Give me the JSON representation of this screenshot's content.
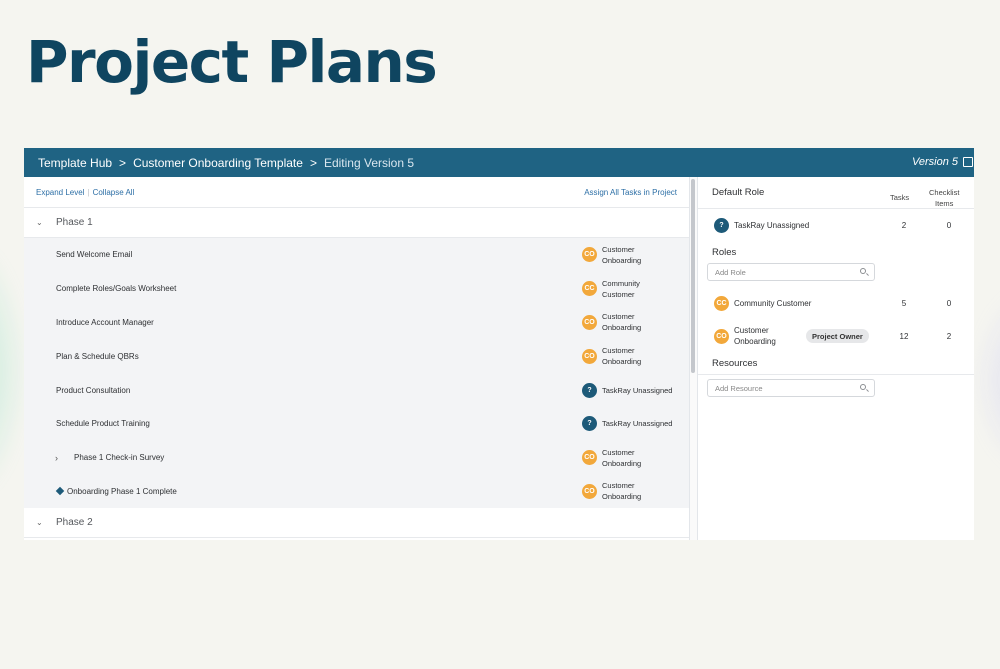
{
  "page": {
    "title": "Project Plans"
  },
  "breadcrumb": {
    "items": [
      "Template Hub",
      "Customer Onboarding Template",
      "Editing Version 5"
    ],
    "separator": ">",
    "version_label": "Version 5"
  },
  "toolbar": {
    "expand_level": "Expand Level",
    "collapse_all": "Collapse All",
    "assign_all": "Assign All Tasks in Project"
  },
  "phases": [
    {
      "label": "Phase 1",
      "expanded": true,
      "tasks": [
        {
          "name": "Send Welcome Email",
          "owner_line1": "Customer",
          "owner_line2": "Onboarding",
          "owner_type": "CO"
        },
        {
          "name": "Complete Roles/Goals Worksheet",
          "owner_line1": "Community",
          "owner_line2": "Customer",
          "owner_type": "CC"
        },
        {
          "name": "Introduce Account Manager",
          "owner_line1": "Customer",
          "owner_line2": "Onboarding",
          "owner_type": "CO"
        },
        {
          "name": "Plan & Schedule QBRs",
          "owner_line1": "Customer",
          "owner_line2": "Onboarding",
          "owner_type": "CO"
        },
        {
          "name": "Product Consultation",
          "owner_line1": "TaskRay Unassigned",
          "owner_line2": "",
          "owner_type": "?"
        },
        {
          "name": "Schedule Product Training",
          "owner_line1": "TaskRay Unassigned",
          "owner_line2": "",
          "owner_type": "?"
        },
        {
          "name": "Phase 1 Check-in Survey",
          "owner_line1": "Customer",
          "owner_line2": "Onboarding",
          "owner_type": "CO"
        },
        {
          "name": "Onboarding Phase 1 Complete",
          "owner_line1": "Customer",
          "owner_line2": "Onboarding",
          "owner_type": "CO"
        }
      ]
    },
    {
      "label": "Phase 2",
      "expanded": true,
      "tasks": []
    }
  ],
  "right_panel": {
    "default_role_title": "Default Role",
    "col_tasks": "Tasks",
    "col_checklist_1": "Checklist",
    "col_checklist_2": "Items",
    "default_role": {
      "badge": "?",
      "name": "TaskRay Unassigned",
      "tasks": "2",
      "checklist": "0"
    },
    "roles_title": "Roles",
    "add_role_placeholder": "Add Role",
    "roles": [
      {
        "badge": "CC",
        "name": "Community Customer",
        "name2": "",
        "tasks": "5",
        "checklist": "0",
        "pill": ""
      },
      {
        "badge": "CO",
        "name": "Customer",
        "name2": "Onboarding",
        "tasks": "12",
        "checklist": "2",
        "pill": "Project Owner"
      }
    ],
    "resources_title": "Resources",
    "add_resource_placeholder": "Add Resource"
  },
  "colors": {
    "title": "#0f4560",
    "topbar": "#1f6383",
    "avatar_orange": "#f2a83b",
    "avatar_blue": "#1d5a79",
    "link": "#2d6fa6"
  },
  "icons": {
    "edit": "edit-icon",
    "search": "search-icon",
    "chevron_down": "chevron-down-icon",
    "chevron_right": "chevron-right-icon",
    "milestone": "milestone-diamond-icon"
  }
}
